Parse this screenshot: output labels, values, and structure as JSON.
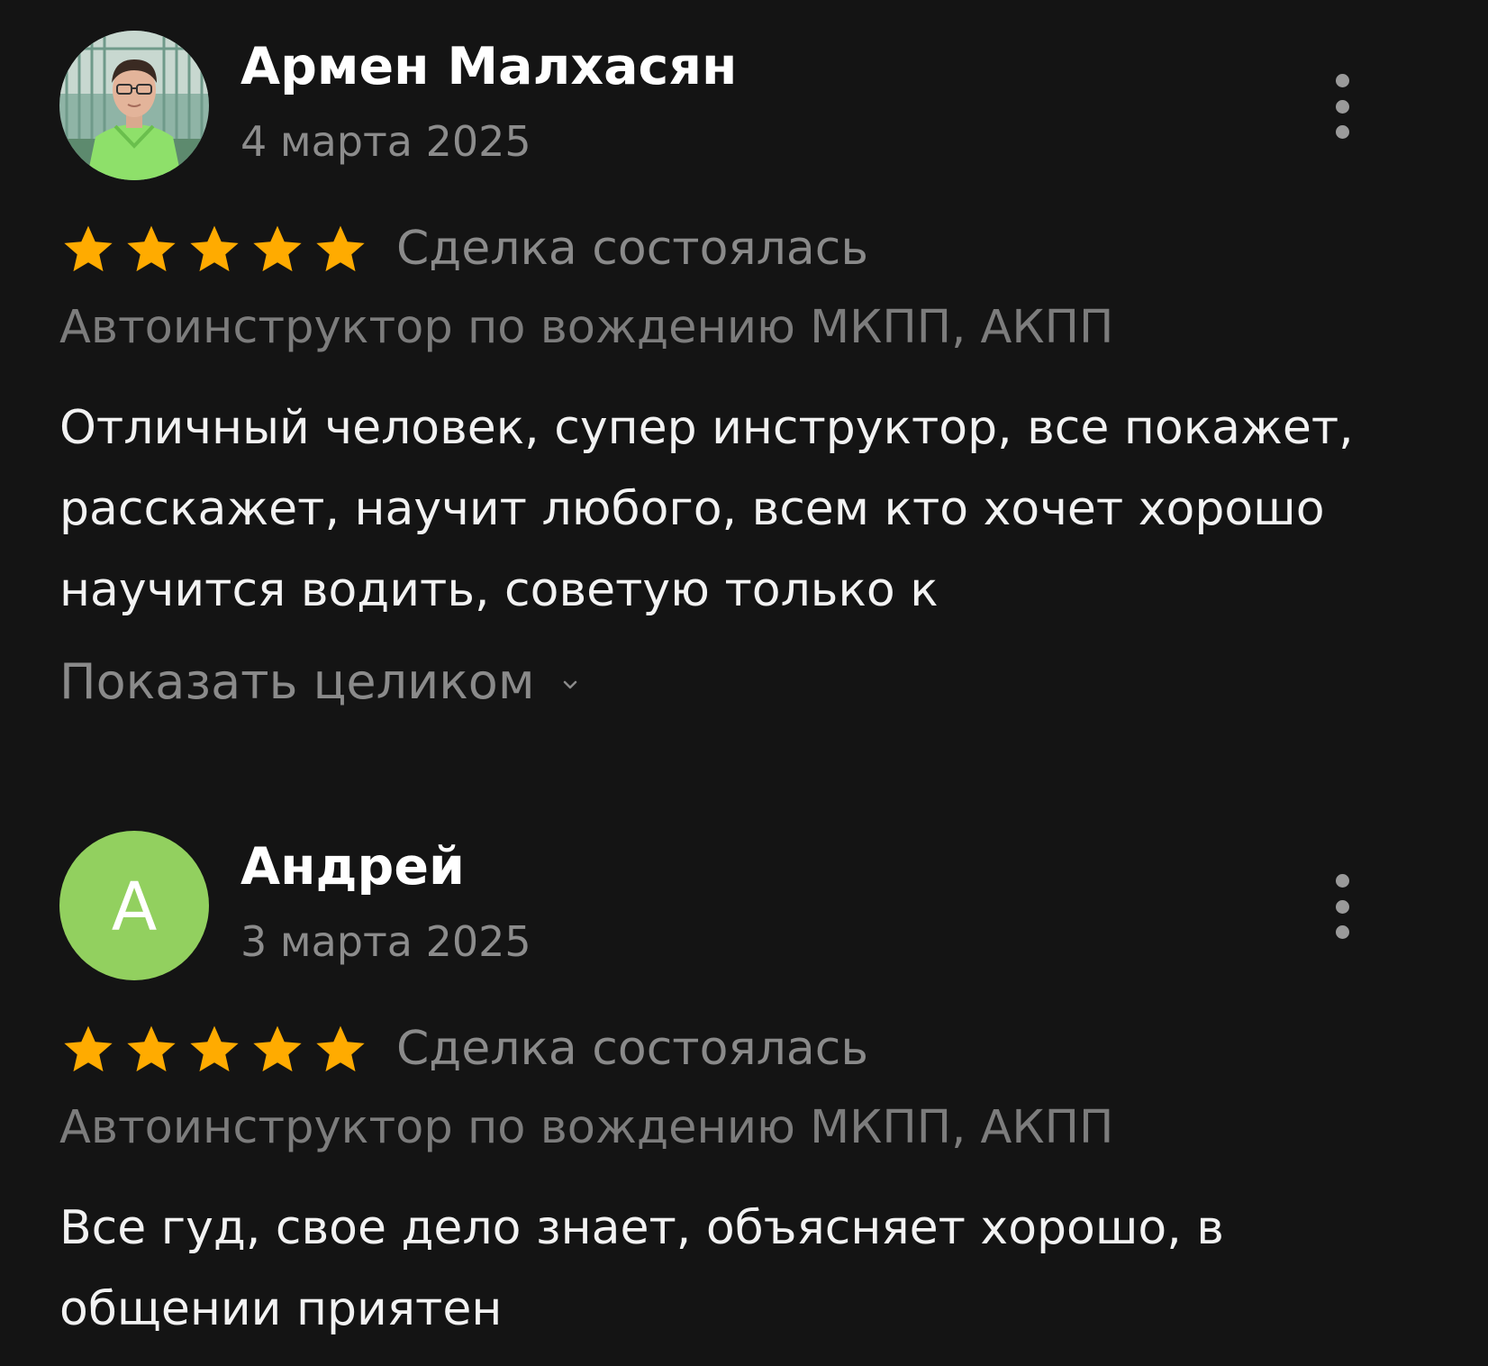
{
  "colors": {
    "background": "#141414",
    "star": "#ffab00",
    "letter_avatar": "#92d05f",
    "secondary_text": "#8a8a8a"
  },
  "reviews": [
    {
      "author": "Армен Малхасян",
      "date": "4 марта 2025",
      "avatar_type": "photo",
      "rating": 5,
      "deal_status": "Сделка состоялась",
      "service": "Автоинструктор по вождению МКПП, АКПП",
      "text": "Отличный человек, супер инструктор, все покажет, расскажет, научит любого, всем кто хочет хорошо научится водить, советую только к",
      "show_more": "Показать целиком",
      "icons": {
        "menu": "more-vertical-icon",
        "expand": "chevron-down-icon",
        "star": "star-icon"
      }
    },
    {
      "author": "Андрей",
      "date": "3 марта 2025",
      "avatar_type": "letter",
      "avatar_letter": "А",
      "rating": 5,
      "deal_status": "Сделка состоялась",
      "service": "Автоинструктор по вождению МКПП, АКПП",
      "text": "Все гуд, свое дело знает, объясняет хорошо, в общении приятен",
      "icons": {
        "menu": "more-vertical-icon",
        "star": "star-icon"
      }
    }
  ]
}
